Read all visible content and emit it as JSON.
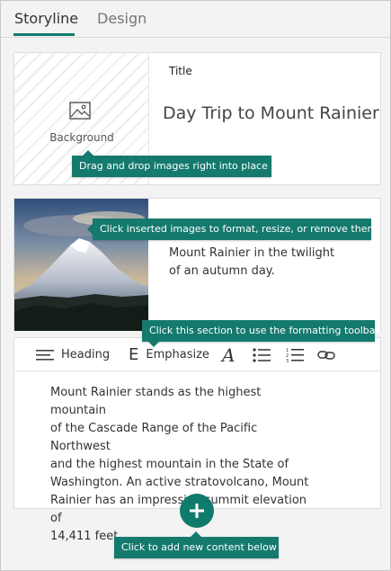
{
  "tabs": [
    {
      "label": "Storyline",
      "selected": true
    },
    {
      "label": "Design",
      "selected": false
    }
  ],
  "title_card": {
    "background_label": "Background",
    "title_label": "Title",
    "title_text": "Day Trip to Mount Rainier",
    "background_icon": "image-icon"
  },
  "image_card": {
    "caption_line1": "Mount Rainier in the twilight",
    "caption_line2": "of an autumn day."
  },
  "text_card": {
    "toolbar": {
      "heading_label": "Heading",
      "emphasize_label": "Emphasize",
      "emphasize_glyph": "E",
      "font_glyph": "A"
    },
    "body_lines": [
      "Mount Rainier stands as the highest mountain",
      "of the Cascade Range of the Pacific Northwest",
      "and the highest mountain in the State of",
      "Washington. An active stratovolcano, Mount",
      "Rainier has an impressive summit elevation of",
      "14,411 feet."
    ]
  },
  "tooltips": {
    "drag_drop": "Drag and drop images right into place",
    "inserted_images": "Click inserted images to format, resize, or remove them",
    "formatting_toolbar": "Click this section to use the formatting toolbar",
    "add_content": "Click to add new content below"
  },
  "colors": {
    "accent": "#0f7b6c",
    "tooltip_bg": "#157a6e",
    "panel_bg": "#f3f3f3"
  }
}
